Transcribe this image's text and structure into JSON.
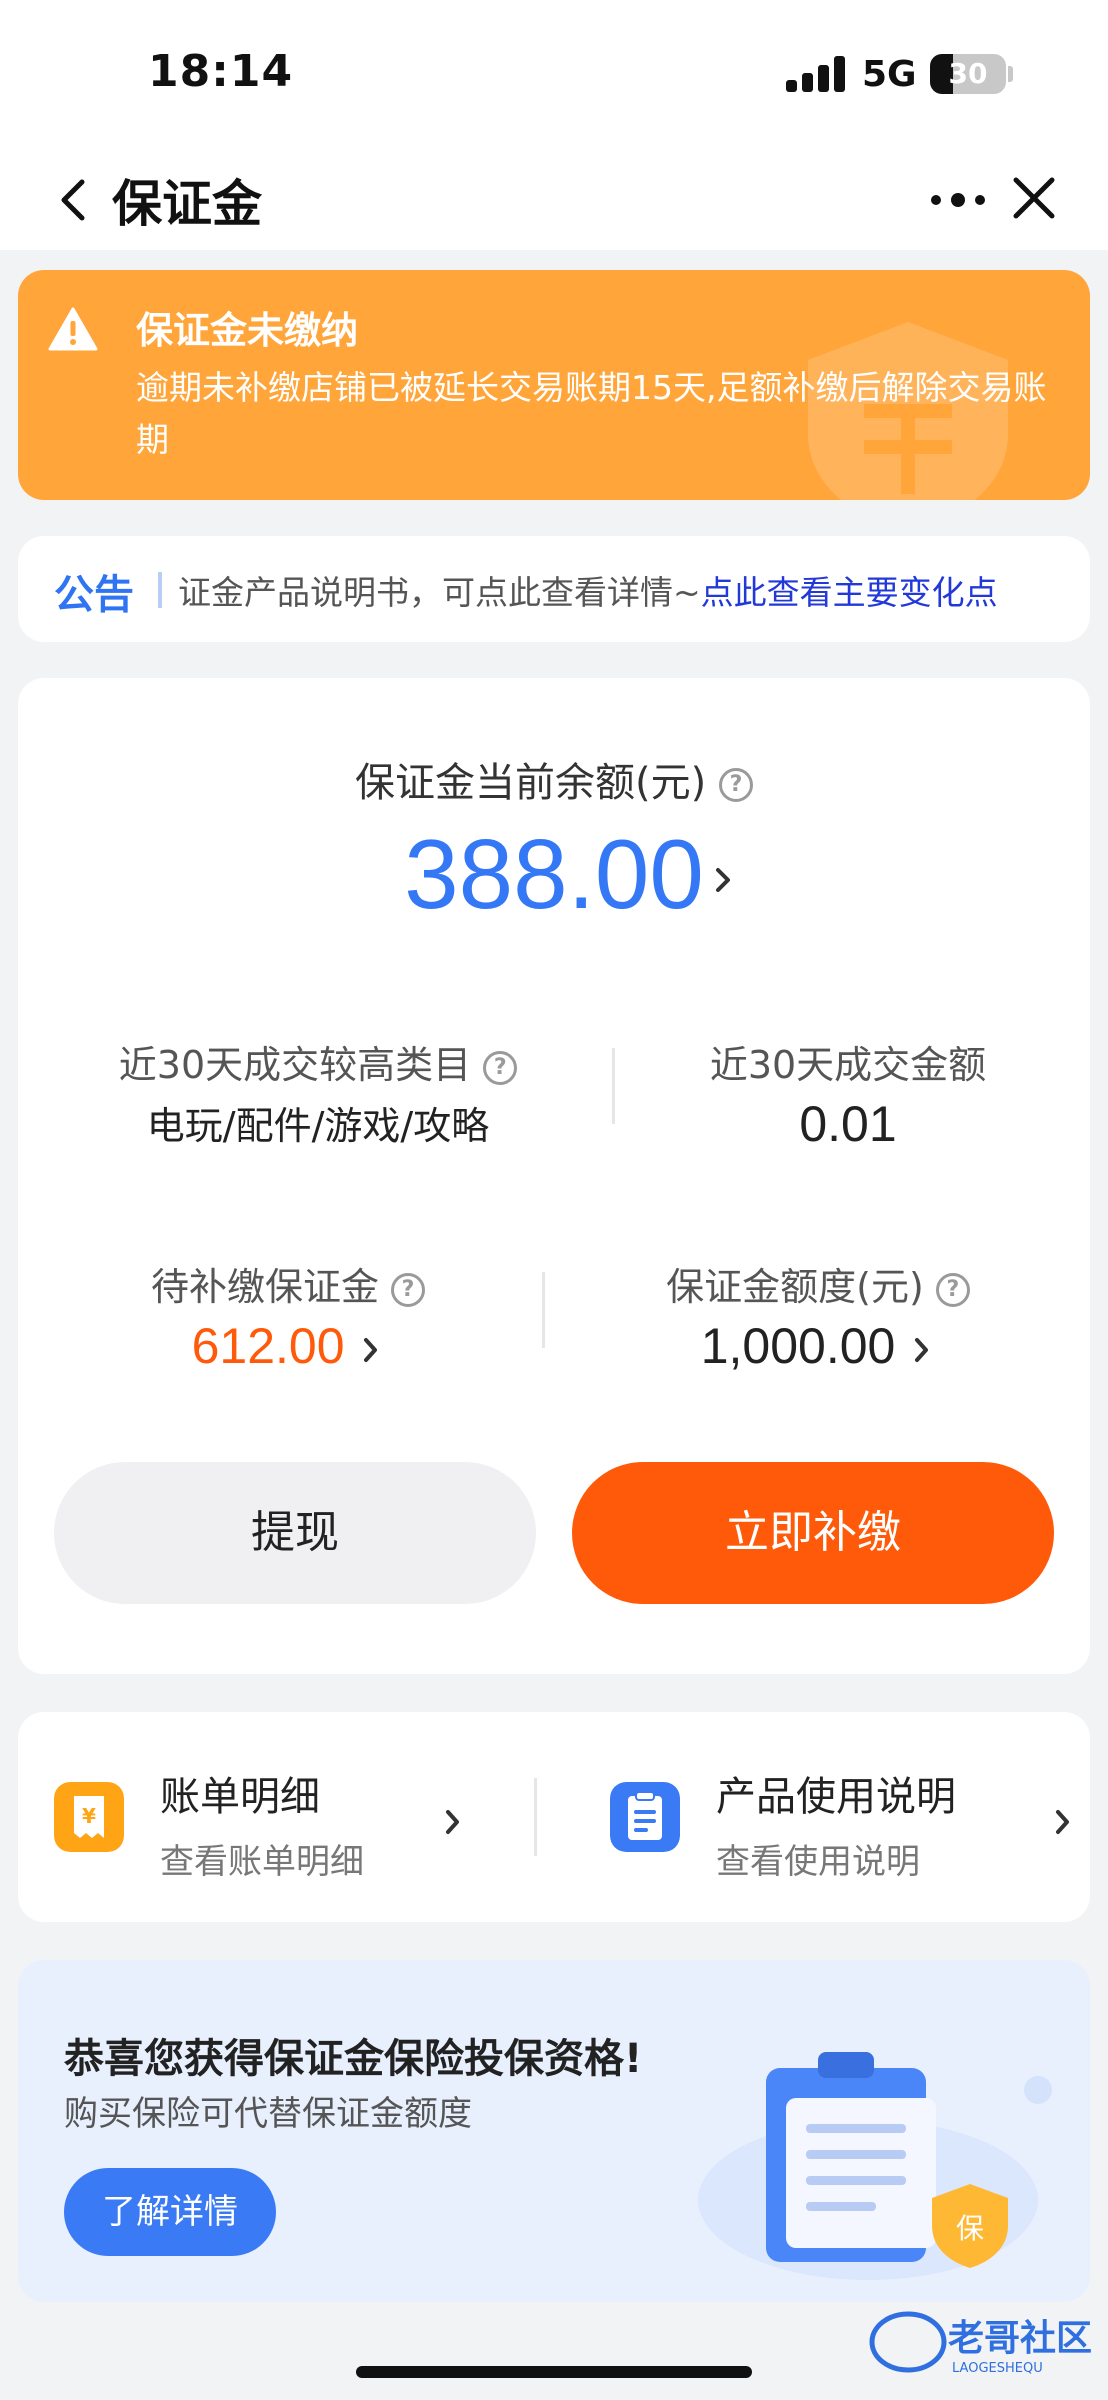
{
  "status": {
    "time": "18:14",
    "network": "5G",
    "battery": "30",
    "battery_level": 0.3
  },
  "nav": {
    "title": "保证金",
    "back_icon": "chevron-left-icon",
    "more_icon": "more-dots-icon",
    "close_icon": "close-icon"
  },
  "warning": {
    "title": "保证金未缴纳",
    "description": "逾期未补缴店铺已被延长交易账期15天,足额补缴后解除交易账期",
    "icon": "warning-triangle-icon",
    "color": "#ffa53a"
  },
  "notice": {
    "label": "公告",
    "text": "证金产品说明书，可点此查看详情~",
    "link": "点此查看主要变化点"
  },
  "balance": {
    "label": "保证金当前余额(元)",
    "value": "388.00",
    "color": "#3478f6"
  },
  "stats": {
    "top_category_label": "近30天成交较高类目",
    "top_category_value": "电玩/配件/游戏/攻略",
    "amount_label": "近30天成交金额",
    "amount_value": "0.01",
    "pending_label": "待补缴保证金",
    "pending_value": "612.00",
    "pending_color": "#ff5a0a",
    "quota_label": "保证金额度(元)",
    "quota_value": "1,000.00"
  },
  "buttons": {
    "withdraw": "提现",
    "pay_now": "立即补缴"
  },
  "links": [
    {
      "title": "账单明细",
      "subtitle": "查看账单明细",
      "icon": "bill-icon",
      "color": "#ffa414"
    },
    {
      "title": "产品使用说明",
      "subtitle": "查看使用说明",
      "icon": "document-icon",
      "color": "#3a7af5"
    }
  ],
  "promo": {
    "title": "恭喜您获得保证金保险投保资格!",
    "subtitle": "购买保险可代替保证金额度",
    "button": "了解详情",
    "shield_text": "保"
  },
  "watermark": {
    "text": "老哥社区",
    "subtext": "LAOGESHEQU"
  }
}
